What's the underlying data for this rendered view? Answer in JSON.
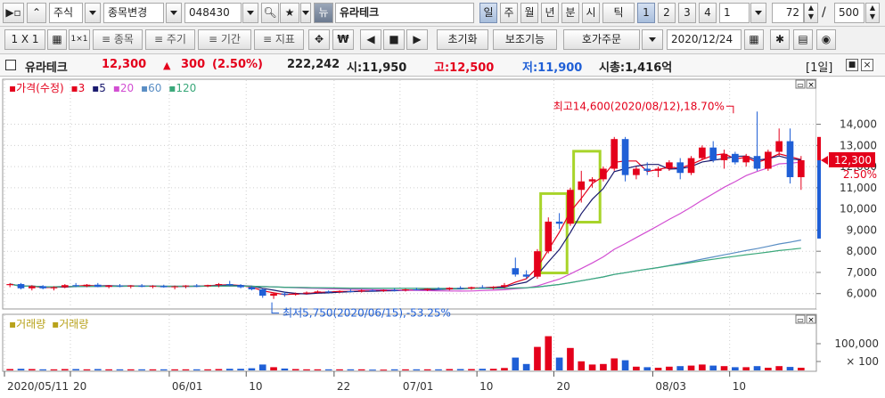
{
  "toolbar1": {
    "market": "주식",
    "change_item": "종목변경",
    "code": "048430",
    "stock_name": "유라테크",
    "periods": [
      "일",
      "주",
      "월",
      "년",
      "분",
      "시",
      "틱"
    ],
    "tick_numbers": [
      "1",
      "2",
      "3",
      "4"
    ],
    "interval_value": "1",
    "count_value": "72",
    "separator": "/",
    "total_value": "500"
  },
  "toolbar2": {
    "layout_1x1": "1 X 1",
    "item_button": "종목",
    "cycle_button": "주기",
    "period_button": "기간",
    "indicator_button": "지표",
    "won_icon_text": "₩",
    "init_button": "초기화",
    "aux_button": "보조기능",
    "order_button": "호가주문",
    "date": "2020/12/24"
  },
  "info": {
    "name": "유라테크",
    "price": "12,300",
    "change_arrow": "▲",
    "change": "300",
    "change_pct": "(2.50%)",
    "volume": "222,242",
    "open_label": "시:",
    "open": "11,950",
    "high_label": "고:",
    "high": "12,500",
    "low_label": "저:",
    "low": "11,900",
    "mcap_label": "시총:",
    "mcap": "1,416억",
    "period_badge": "[1일]"
  },
  "colors": {
    "up": "#e4001b",
    "down": "#1f5fd6",
    "ma3": "#e4001b",
    "ma5": "#1a1a6e",
    "ma20": "#d24ed2",
    "ma60": "#5a8ec4",
    "ma120": "#3aa87a",
    "highlight": "#a8d42a",
    "volume_legend": "#b8a21b"
  },
  "chart_data": {
    "type": "candlestick",
    "legend": {
      "price_label": "가격(수정)",
      "ma": [
        {
          "name": "3",
          "color": "#e4001b"
        },
        {
          "name": "5",
          "color": "#1a1a6e"
        },
        {
          "name": "20",
          "color": "#d24ed2"
        },
        {
          "name": "60",
          "color": "#5a8ec4"
        },
        {
          "name": "120",
          "color": "#3aa87a"
        }
      ]
    },
    "volume_legend": [
      "거래량",
      "거래량"
    ],
    "ylim": [
      5400,
      16000
    ],
    "y_ticks": [
      6000,
      7000,
      8000,
      9000,
      10000,
      11000,
      12000,
      13000,
      14000
    ],
    "y_tick_labels": [
      "6,000",
      "7,000",
      "8,000",
      "9,000",
      "10,000",
      "11,000",
      "12,000",
      "13,000",
      "14,000"
    ],
    "volume_ylim": [
      0,
      150000
    ],
    "volume_ticks": [
      100000,
      100
    ],
    "volume_tick_labels": [
      "100,000",
      "× 100"
    ],
    "current_price_label": "12,300",
    "current_pct_label": "2.50%",
    "current_price": 12300,
    "x_labels": [
      {
        "index": 0,
        "text": "2020/05/11"
      },
      {
        "index": 6,
        "text": "20"
      },
      {
        "index": 15,
        "text": "06/01"
      },
      {
        "index": 22,
        "text": "10"
      },
      {
        "index": 30,
        "text": "22"
      },
      {
        "index": 36,
        "text": "07/01"
      },
      {
        "index": 43,
        "text": "10"
      },
      {
        "index": 50,
        "text": "20"
      },
      {
        "index": 59,
        "text": "08/03"
      },
      {
        "index": 66,
        "text": "10"
      }
    ],
    "high_annotation": {
      "text": "최고14,600(2020/08/12),18.70%",
      "index": 66,
      "value": 14600
    },
    "low_annotation": {
      "text": "최저5,750(2020/06/15),-53.25%",
      "index": 24,
      "value": 5750
    },
    "highlight_ranges": [
      [
        49,
        50
      ],
      [
        52,
        53
      ]
    ],
    "candles": [
      [
        6400,
        6500,
        6300,
        6450,
        5000
      ],
      [
        6450,
        6500,
        6200,
        6250,
        6000
      ],
      [
        6250,
        6400,
        6150,
        6350,
        5000
      ],
      [
        6350,
        6400,
        6200,
        6250,
        4000
      ],
      [
        6250,
        6350,
        6150,
        6300,
        4000
      ],
      [
        6300,
        6450,
        6250,
        6400,
        5000
      ],
      [
        6400,
        6500,
        6300,
        6350,
        5000
      ],
      [
        6350,
        6450,
        6300,
        6420,
        4000
      ],
      [
        6420,
        6500,
        6300,
        6320,
        5000
      ],
      [
        6320,
        6400,
        6250,
        6380,
        4000
      ],
      [
        6380,
        6450,
        6300,
        6340,
        4000
      ],
      [
        6340,
        6400,
        6250,
        6380,
        4000
      ],
      [
        6380,
        6450,
        6300,
        6330,
        4000
      ],
      [
        6330,
        6400,
        6250,
        6360,
        4000
      ],
      [
        6360,
        6420,
        6280,
        6300,
        4000
      ],
      [
        6300,
        6380,
        6200,
        6340,
        4000
      ],
      [
        6340,
        6400,
        6250,
        6380,
        4000
      ],
      [
        6380,
        6450,
        6300,
        6350,
        4000
      ],
      [
        6350,
        6420,
        6300,
        6400,
        4000
      ],
      [
        6400,
        6500,
        6300,
        6450,
        5000
      ],
      [
        6450,
        6600,
        6350,
        6400,
        6000
      ],
      [
        6400,
        6450,
        6250,
        6300,
        6000
      ],
      [
        6300,
        6350,
        6150,
        6200,
        8000
      ],
      [
        6200,
        6250,
        5800,
        5900,
        22000
      ],
      [
        5900,
        6050,
        5750,
        6000,
        12000
      ],
      [
        6000,
        6100,
        5850,
        5950,
        7000
      ],
      [
        5950,
        6050,
        5900,
        6000,
        5000
      ],
      [
        6000,
        6100,
        5950,
        6050,
        4000
      ],
      [
        6050,
        6150,
        6000,
        6100,
        4000
      ],
      [
        6100,
        6150,
        6020,
        6070,
        4000
      ],
      [
        6070,
        6150,
        6020,
        6120,
        4000
      ],
      [
        6120,
        6200,
        6050,
        6100,
        4000
      ],
      [
        6100,
        6200,
        6050,
        6150,
        4000
      ],
      [
        6150,
        6200,
        6100,
        6120,
        3000
      ],
      [
        6120,
        6200,
        6080,
        6170,
        3000
      ],
      [
        6170,
        6250,
        6100,
        6150,
        4000
      ],
      [
        6150,
        6230,
        6100,
        6200,
        4000
      ],
      [
        6200,
        6280,
        6150,
        6170,
        4000
      ],
      [
        6170,
        6250,
        6120,
        6230,
        4000
      ],
      [
        6230,
        6300,
        6180,
        6200,
        4000
      ],
      [
        6200,
        6300,
        6150,
        6270,
        5000
      ],
      [
        6270,
        6350,
        6200,
        6240,
        5000
      ],
      [
        6240,
        6330,
        6180,
        6300,
        5000
      ],
      [
        6300,
        6400,
        6250,
        6280,
        6000
      ],
      [
        6280,
        6350,
        6200,
        6320,
        6000
      ],
      [
        6320,
        6500,
        6250,
        6400,
        9000
      ],
      [
        7200,
        7700,
        6800,
        6900,
        48000
      ],
      [
        6900,
        7100,
        6700,
        6800,
        24000
      ],
      [
        6800,
        8100,
        6700,
        8000,
        88000
      ],
      [
        8000,
        9600,
        7900,
        9400,
        128000
      ],
      [
        9400,
        9800,
        9050,
        9300,
        48000
      ],
      [
        9300,
        11000,
        9200,
        10900,
        84000
      ],
      [
        10900,
        11800,
        10300,
        11300,
        34000
      ],
      [
        11300,
        11500,
        11000,
        11400,
        22000
      ],
      [
        11400,
        12000,
        11300,
        11900,
        24000
      ],
      [
        11900,
        13400,
        11800,
        13300,
        45000
      ],
      [
        13300,
        13400,
        11300,
        11600,
        38000
      ],
      [
        11600,
        12000,
        11400,
        11900,
        14000
      ],
      [
        11900,
        12200,
        11600,
        11800,
        12000
      ],
      [
        11800,
        12000,
        11500,
        11900,
        10000
      ],
      [
        11900,
        12300,
        11800,
        12200,
        14000
      ],
      [
        12200,
        12400,
        11400,
        11700,
        16000
      ],
      [
        11700,
        12500,
        11600,
        12400,
        18000
      ],
      [
        12400,
        13000,
        12300,
        12900,
        22000
      ],
      [
        12900,
        13200,
        12200,
        12300,
        18000
      ],
      [
        12300,
        12800,
        11900,
        12600,
        16000
      ],
      [
        12600,
        12700,
        12100,
        12200,
        12000
      ],
      [
        12200,
        12600,
        12000,
        12500,
        12000
      ],
      [
        12500,
        14600,
        11800,
        11900,
        16000
      ],
      [
        11900,
        12800,
        11800,
        12700,
        10000
      ],
      [
        12700,
        13800,
        12500,
        13200,
        16000
      ],
      [
        13200,
        13800,
        11200,
        11500,
        13000
      ],
      [
        11500,
        12500,
        10900,
        12300,
        10000
      ]
    ]
  }
}
